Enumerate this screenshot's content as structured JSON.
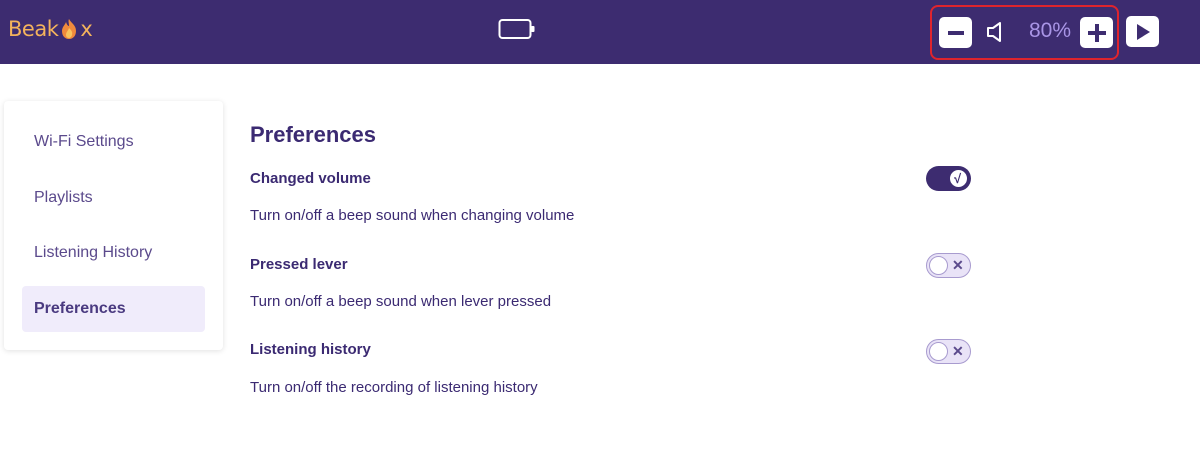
{
  "header": {
    "logo_text_left": "Beak",
    "logo_text_right": "x",
    "volume_level": "80%",
    "colors": {
      "header_bg": "#3d2c70",
      "logo": "#f4b35c",
      "volume_text": "#a995e6",
      "highlight_border": "#e0242d"
    },
    "icons": [
      "battery-icon",
      "minus-icon",
      "speaker-icon",
      "plus-icon",
      "play-icon"
    ]
  },
  "sidebar": {
    "items": [
      {
        "label": "Wi-Fi Settings",
        "active": false
      },
      {
        "label": "Playlists",
        "active": false
      },
      {
        "label": "Listening History",
        "active": false
      },
      {
        "label": "Preferences",
        "active": true
      }
    ]
  },
  "main": {
    "title": "Preferences",
    "preferences": [
      {
        "title": "Changed volume",
        "description": "Turn on/off a beep sound when changing volume",
        "enabled": true,
        "mark": "√"
      },
      {
        "title": "Pressed lever",
        "description": "Turn on/off a beep sound when lever pressed",
        "enabled": false,
        "mark": "✕"
      },
      {
        "title": "Listening history",
        "description": "Turn on/off the recording of listening history",
        "enabled": false,
        "mark": "✕"
      }
    ]
  }
}
